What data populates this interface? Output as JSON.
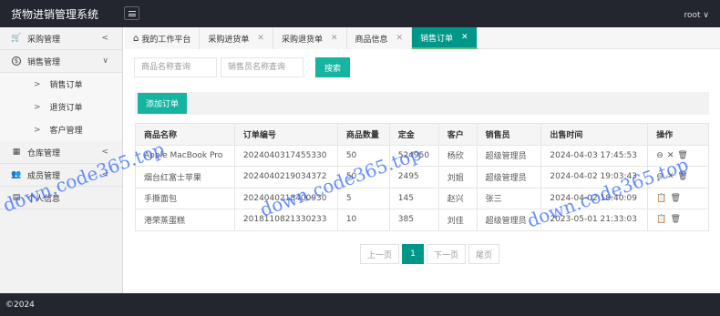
{
  "app": {
    "title": "货物进销管理系统",
    "user": "root ∨"
  },
  "sidebar": {
    "items": [
      {
        "icon": "cart-icon",
        "glyph": "🛒",
        "label": "采购管理",
        "arrow": "<"
      },
      {
        "icon": "dollar-circle-icon",
        "glyph": "$",
        "label": "销售管理",
        "arrow": "∨"
      },
      {
        "icon": "warehouse-icon",
        "glyph": "▦",
        "label": "仓库管理",
        "arrow": "<"
      },
      {
        "icon": "users-icon",
        "glyph": "👥",
        "label": "成员管理",
        "arrow": "<"
      },
      {
        "icon": "profile-card-icon",
        "glyph": "▤",
        "label": "个人信息",
        "arrow": ""
      }
    ],
    "sales_sub": [
      {
        "label": "销售订单"
      },
      {
        "label": "退货订单"
      },
      {
        "label": "客户管理"
      }
    ]
  },
  "tabs": [
    {
      "label": "我的工作平台",
      "closable": false
    },
    {
      "label": "采购进货单",
      "closable": true
    },
    {
      "label": "采购退货单",
      "closable": true
    },
    {
      "label": "商品信息",
      "closable": true
    },
    {
      "label": "销售订单",
      "closable": true,
      "active": true
    }
  ],
  "search": {
    "product_placeholder": "商品名称查询",
    "seller_placeholder": "销售员名称查询",
    "button": "搜索"
  },
  "toolbar": {
    "add_label": "添加订单"
  },
  "table": {
    "headers": [
      "商品名称",
      "订单编号",
      "商品数量",
      "定金",
      "客户",
      "销售员",
      "出售时间",
      "操作"
    ],
    "rows": [
      {
        "cells": [
          "Apple MacBook Pro",
          "2024040317455330",
          "50",
          "524950",
          "杨欣",
          "超级管理员",
          "2024-04-03 17:45:53"
        ],
        "ops": [
          "⊖",
          "✕",
          "🗑"
        ]
      },
      {
        "cells": [
          "烟台红富士苹果",
          "2024040219034372",
          "50",
          "2495",
          "刘姐",
          "超级管理员",
          "2024-04-02 19:03:43"
        ],
        "ops": [
          "⊖",
          "✕",
          "🗑"
        ]
      },
      {
        "cells": [
          "手撕面包",
          "2024040218400930",
          "5",
          "145",
          "赵兴",
          "张三",
          "2024-04-02 18:40:09"
        ],
        "ops": [
          "📋",
          "🗑"
        ]
      },
      {
        "cells": [
          "港荣蒸蛋糕",
          "2018110821330233",
          "10",
          "385",
          "刘佳",
          "超级管理员",
          "2023-05-01 21:33:03"
        ],
        "ops": [
          "📋",
          "🗑"
        ]
      }
    ]
  },
  "pager": {
    "prev": "上一页",
    "current": "1",
    "next": "下一页",
    "last": "尾页"
  },
  "footer": {
    "text": "©2024"
  },
  "watermark": {
    "text": "down.code365.top"
  },
  "colors": {
    "accent": "#009688",
    "button": "#16b5a2",
    "header_bg": "#23262e",
    "watermark": "#3468ff"
  }
}
